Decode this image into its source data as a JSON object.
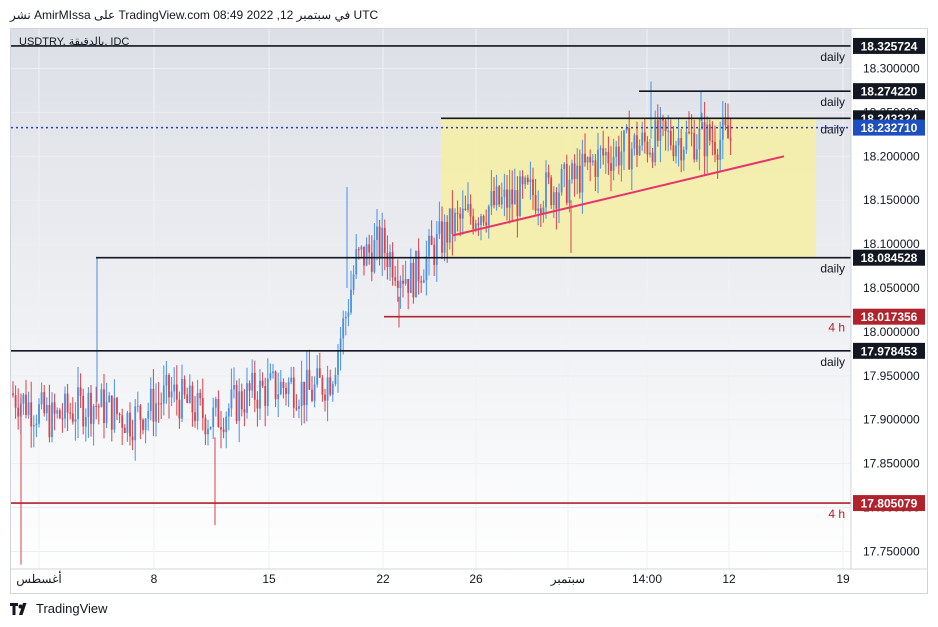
{
  "caption": "نشر AmirMIssa على TradingView.com في سبتمبر 12, 2022 08:49 UTC",
  "symbol_label": "USDTRY, بالدقيقة, IDC",
  "footer": {
    "brand": "TradingView"
  },
  "colors": {
    "up": "#4a90e2",
    "down": "#d9414c",
    "zone": "#f6eea3",
    "trend": "#e8336c",
    "black_line": "#131722",
    "red_line": "#b0232c",
    "blue_line": "#2a3fbf",
    "tag_red": "#b0232c",
    "tag_blue": "#1e4fbf",
    "tag_black": "#131722"
  },
  "chart_data": {
    "type": "candlestick",
    "ylim": [
      17.73,
      18.345
    ],
    "y_ticks": [
      "18.300000",
      "18.250000",
      "18.200000",
      "18.150000",
      "18.100000",
      "18.050000",
      "18.000000",
      "17.950000",
      "17.900000",
      "17.850000",
      "17.800000",
      "17.750000"
    ],
    "x_ticks": [
      "أغسطس",
      "8",
      "15",
      "22",
      "26",
      "سبتمبر",
      "14:00",
      "12",
      "19"
    ],
    "levels": [
      {
        "value": 18.325724,
        "label": "18.325724",
        "note": "daily",
        "style": "black"
      },
      {
        "value": 18.27422,
        "label": "18.274220",
        "note": "daily",
        "style": "black"
      },
      {
        "value": 18.243324,
        "label": "18.243324",
        "note": "daily",
        "style": "black"
      },
      {
        "value": 18.23271,
        "label": "18.232710",
        "note": "",
        "style": "blue"
      },
      {
        "value": 18.084528,
        "label": "18.084528",
        "note": "daily",
        "style": "black"
      },
      {
        "value": 18.017356,
        "label": "18.017356",
        "note": "4 h",
        "style": "red"
      },
      {
        "value": 17.978453,
        "label": "17.978453",
        "note": "daily",
        "style": "black"
      },
      {
        "value": 17.805079,
        "label": "17.805079",
        "note": "4 h",
        "style": "red"
      }
    ],
    "zone": {
      "top": 18.243324,
      "bottom": 18.084528
    },
    "trendline": {
      "from": 18.11,
      "to": 18.2
    },
    "candles": []
  }
}
